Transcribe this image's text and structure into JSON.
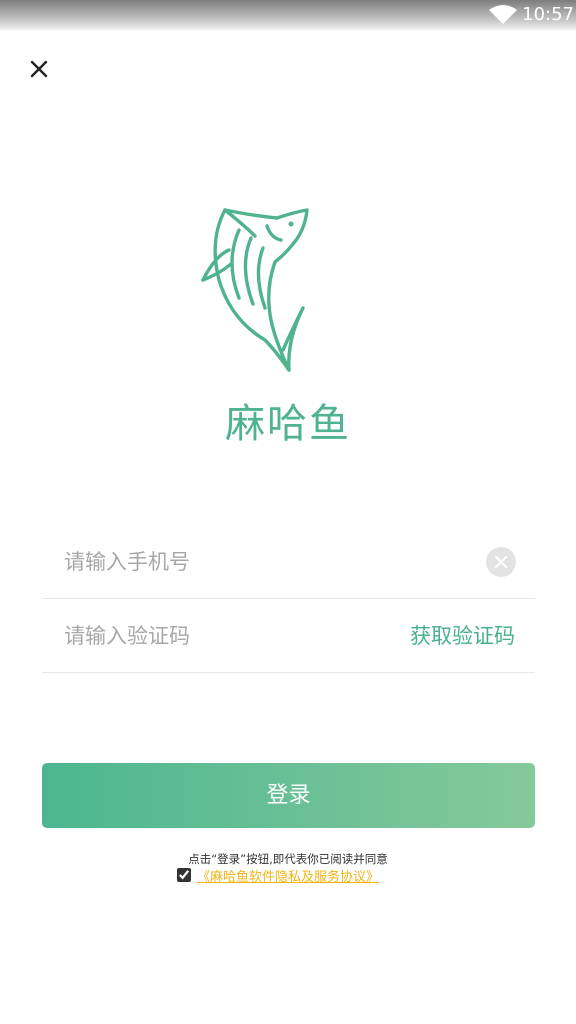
{
  "status_bar": {
    "time": "10:57"
  },
  "brand": {
    "name": "麻哈鱼",
    "color": "#4fb38d"
  },
  "form": {
    "phone_placeholder": "请输入手机号",
    "phone_value": "",
    "code_placeholder": "请输入验证码",
    "code_value": "",
    "get_code_label": "获取验证码"
  },
  "login": {
    "label": "登录",
    "gradient": [
      "#4db690",
      "#85c99a"
    ]
  },
  "agreement": {
    "notice": "点击“登录”按钮,即代表你已阅读并同意",
    "checked": true,
    "link_text": "《麻哈鱼软件隐私及服务协议》",
    "link_color": "#f0b413"
  },
  "icons": {
    "close": "close-icon",
    "clear": "clear-circle-icon",
    "wifi": "wifi-icon",
    "logo": "fish-logo-icon"
  }
}
